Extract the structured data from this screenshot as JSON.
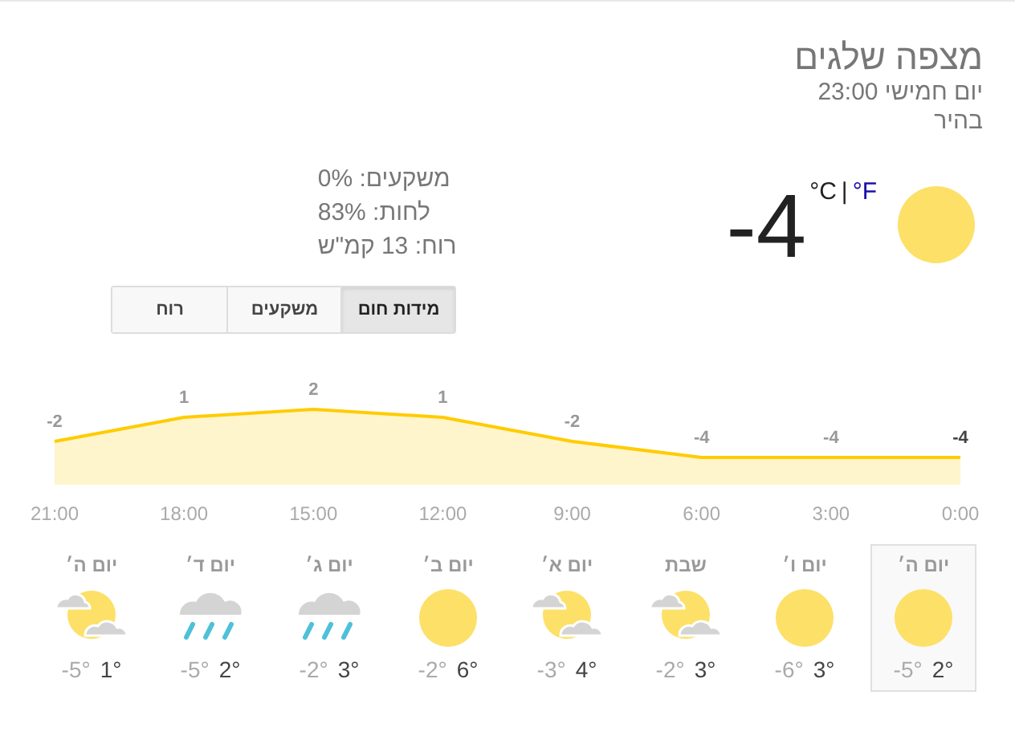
{
  "location": "מצפה שלגים",
  "time": "יום חמישי 23:00",
  "condition": "בהיר",
  "current": {
    "temperature": "-4",
    "unit_c": "°C",
    "separator": "|",
    "unit_f": "°F"
  },
  "details": [
    "משקעים: 0%",
    "לחות: 83%",
    "רוח: 13 קמ\"ש"
  ],
  "tabs": [
    {
      "label": "מידות חום",
      "selected": true
    },
    {
      "label": "משקעים",
      "selected": false
    },
    {
      "label": "רוח",
      "selected": false
    }
  ],
  "chart_data": {
    "type": "area",
    "categories": [
      "21:00",
      "18:00",
      "15:00",
      "12:00",
      "9:00",
      "6:00",
      "3:00",
      "0:00"
    ],
    "series": [
      {
        "color": "#ffcc00",
        "values": [
          -2,
          1,
          2,
          1,
          -2,
          -4,
          -4,
          -4
        ]
      }
    ],
    "data_labels": true
  },
  "days": [
    {
      "name": "יום ה׳",
      "kind": "sun",
      "high": "2°",
      "low": "-5°",
      "selected": true
    },
    {
      "name": "יום ו׳",
      "kind": "sun",
      "high": "3°",
      "low": "-6°",
      "selected": false
    },
    {
      "name": "שבת",
      "kind": "partly_cloudy",
      "high": "3°",
      "low": "-2°",
      "selected": false
    },
    {
      "name": "יום א׳",
      "kind": "partly_cloudy",
      "high": "4°",
      "low": "-3°",
      "selected": false
    },
    {
      "name": "יום ב׳",
      "kind": "sun",
      "high": "6°",
      "low": "-2°",
      "selected": false
    },
    {
      "name": "יום ג׳",
      "kind": "rain",
      "high": "3°",
      "low": "-2°",
      "selected": false
    },
    {
      "name": "יום ד׳",
      "kind": "rain",
      "high": "2°",
      "low": "-5°",
      "selected": false
    },
    {
      "name": "יום ה׳",
      "kind": "partly_cloudy",
      "high": "1°",
      "low": "-5°",
      "selected": false
    }
  ]
}
